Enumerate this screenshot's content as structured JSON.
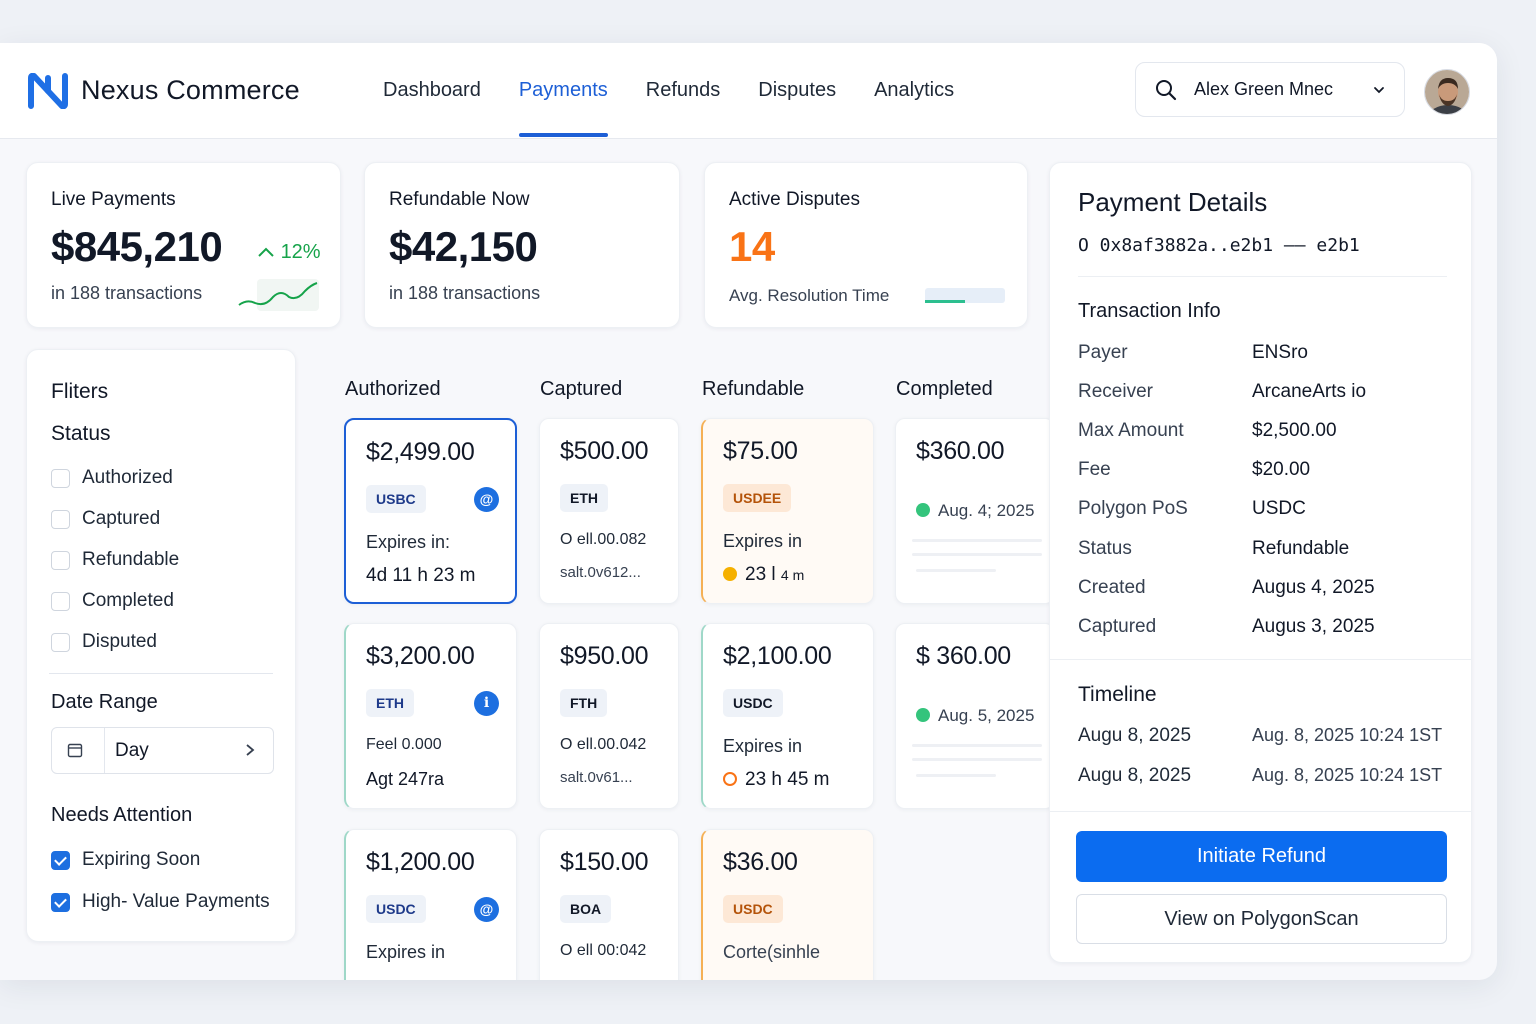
{
  "app": {
    "brand": "Nexus Commerce"
  },
  "nav": {
    "items": [
      {
        "label": "Dashboard",
        "active": false
      },
      {
        "label": "Payments",
        "active": true
      },
      {
        "label": "Refunds",
        "active": false
      },
      {
        "label": "Disputes",
        "active": false
      },
      {
        "label": "Analytics",
        "active": false
      }
    ]
  },
  "account": {
    "user_name": "Alex Green Mnec"
  },
  "stats": {
    "live": {
      "title": "Live Payments",
      "value": "$845,210",
      "change": "12%",
      "sub": "in 188 transactions"
    },
    "refundable": {
      "title": "Refundable Now",
      "value": "$42,150",
      "sub": "in 188 transactions"
    },
    "disputes": {
      "title": "Active Disputes",
      "value": "14",
      "sub": "Avg. Resolution Time",
      "resolution_progress": 0.5
    }
  },
  "filters": {
    "title": "Fliters",
    "status_title": "Status",
    "status_options": [
      {
        "label": "Authorized",
        "checked": false
      },
      {
        "label": "Captured",
        "checked": false
      },
      {
        "label": "Refundable",
        "checked": false
      },
      {
        "label": "Completed",
        "checked": false
      },
      {
        "label": "Disputed",
        "checked": false
      }
    ],
    "date_range_title": "Date Range",
    "date_range_value": "Day",
    "attention_title": "Needs Attention",
    "attention_options": [
      {
        "label": "Expiring Soon",
        "checked": true
      },
      {
        "label": "High- Value Payments",
        "checked": true
      }
    ]
  },
  "board": {
    "columns": [
      "Authorized",
      "Captured",
      "Refundable",
      "Completed"
    ],
    "cards": {
      "a1": {
        "amount": "$2,499.00",
        "token": "USBC",
        "line1": "Expires in:",
        "line2": "4d 11 h 23 m"
      },
      "a2": {
        "amount": "$3,200.00",
        "token": "ETH",
        "line1": "Feel 0.000",
        "line2": "Agt 247ra"
      },
      "a3": {
        "amount": "$1,200.00",
        "token": "USDC",
        "line1": "Expires in"
      },
      "c1": {
        "amount": "$500.00",
        "token": "ETH",
        "line1": "O ell.00.082",
        "line2": "salt.0v612..."
      },
      "c2": {
        "amount": "$950.00",
        "token": "FTH",
        "line1": "O ell.00.042",
        "line2": "salt.0v61..."
      },
      "c3": {
        "amount": "$150.00",
        "token": "BOA",
        "line1": "O ell 00:042"
      },
      "r1": {
        "amount": "$75.00",
        "token": "USDEE",
        "line1": "Expires in",
        "line2": "23 l",
        "line2b": "4 m"
      },
      "r2": {
        "amount": "$2,100.00",
        "token": "USDC",
        "line1": "Expires in",
        "line2": "23 h 45 m"
      },
      "r3": {
        "amount": "$36.00",
        "token": "USDC",
        "line1": "Corte(sinhle"
      },
      "d1": {
        "amount": "$360.00",
        "date": "Aug. 4; 2025"
      },
      "d2": {
        "amount": "$ 360.00",
        "date": "Aug. 5, 2025"
      }
    }
  },
  "details": {
    "title": "Payment Details",
    "hash": "O 0x8af3882a..e2b1 —— e2b1",
    "info_title": "Transaction Info",
    "info": [
      {
        "key": "Payer",
        "value": "ENSro"
      },
      {
        "key": "Receiver",
        "value": "ArcaneArts io"
      },
      {
        "key": "Max Amount",
        "value": "$2,500.00"
      },
      {
        "key": "Fee",
        "value": "$20.00"
      },
      {
        "key": "Polygon PoS",
        "value": "USDC"
      },
      {
        "key": "Status",
        "value": "Refundable"
      },
      {
        "key": "Created",
        "value": "Augus 4, 2025"
      },
      {
        "key": "Captured",
        "value": "Augus 3, 2025"
      }
    ],
    "timeline_title": "Timeline",
    "timeline": [
      {
        "date": "Augu 8, 2025",
        "time": "Aug. 8, 2025 10:24 1ST"
      },
      {
        "date": "Augu 8, 2025",
        "time": "Aug. 8, 2025 10:24 1ST"
      }
    ],
    "primary_button": "Initiate Refund",
    "secondary_button": "View on PolygonScan"
  },
  "colors": {
    "accent": "#1d5fd6",
    "primary_button": "#0b6cf0",
    "success": "#16a34a",
    "warning": "#f97316",
    "teal": "#2cbf8f"
  }
}
